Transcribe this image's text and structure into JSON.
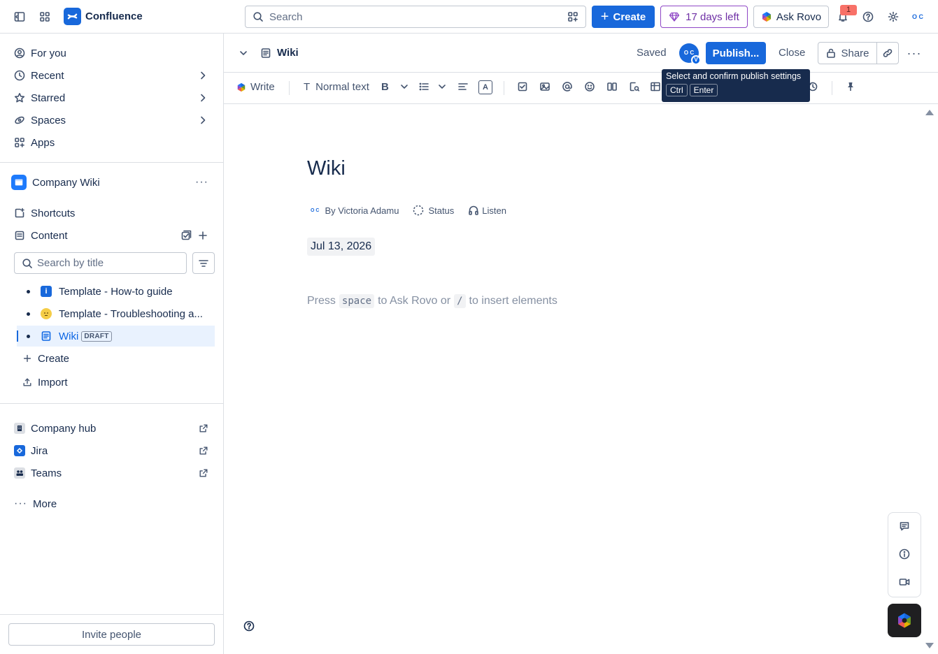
{
  "topbar": {
    "app_name": "Confluence",
    "search_placeholder": "Search",
    "create_label": "Create",
    "trial_label": "17 days left",
    "ask_rovo_label": "Ask Rovo",
    "notification_count": "1",
    "avatar_initials": "O C",
    "brand_color": "#1868db"
  },
  "sidebar": {
    "nav": [
      {
        "label": "For you",
        "icon": "user-circle-icon"
      },
      {
        "label": "Recent",
        "icon": "clock-icon"
      },
      {
        "label": "Starred",
        "icon": "star-icon"
      },
      {
        "label": "Spaces",
        "icon": "spaces-icon"
      },
      {
        "label": "Apps",
        "icon": "apps-icon"
      }
    ],
    "space_name": "Company Wiki",
    "shortcuts_label": "Shortcuts",
    "content_label": "Content",
    "title_search_placeholder": "Search by title",
    "tree": [
      {
        "label": "Template - How-to guide"
      },
      {
        "label": "Template - Troubleshooting a..."
      },
      {
        "label": "Wiki",
        "badge": "DRAFT"
      }
    ],
    "create_label": "Create",
    "import_label": "Import",
    "links": [
      {
        "label": "Company hub"
      },
      {
        "label": "Jira"
      },
      {
        "label": "Teams"
      }
    ],
    "more_label": "More",
    "invite_label": "Invite people"
  },
  "editor": {
    "breadcrumb_title": "Wiki",
    "saved_label": "Saved",
    "avatar_badge": "V",
    "publish_label": "Publish...",
    "close_label": "Close",
    "share_label": "Share",
    "tooltip": {
      "text": "Select and confirm publish settings",
      "keys": [
        "Ctrl",
        "Enter"
      ]
    },
    "toolbar": {
      "write_label": "Write",
      "text_style_label": "Normal text"
    }
  },
  "page": {
    "title": "Wiki",
    "author": "By Victoria Adamu",
    "status_label": "Status",
    "listen_label": "Listen",
    "date": "Jul 13, 2026",
    "placeholder": {
      "part1": "Press",
      "key1": "space",
      "part2": "to Ask Rovo or",
      "key2": "/",
      "part3": "to insert elements"
    }
  }
}
